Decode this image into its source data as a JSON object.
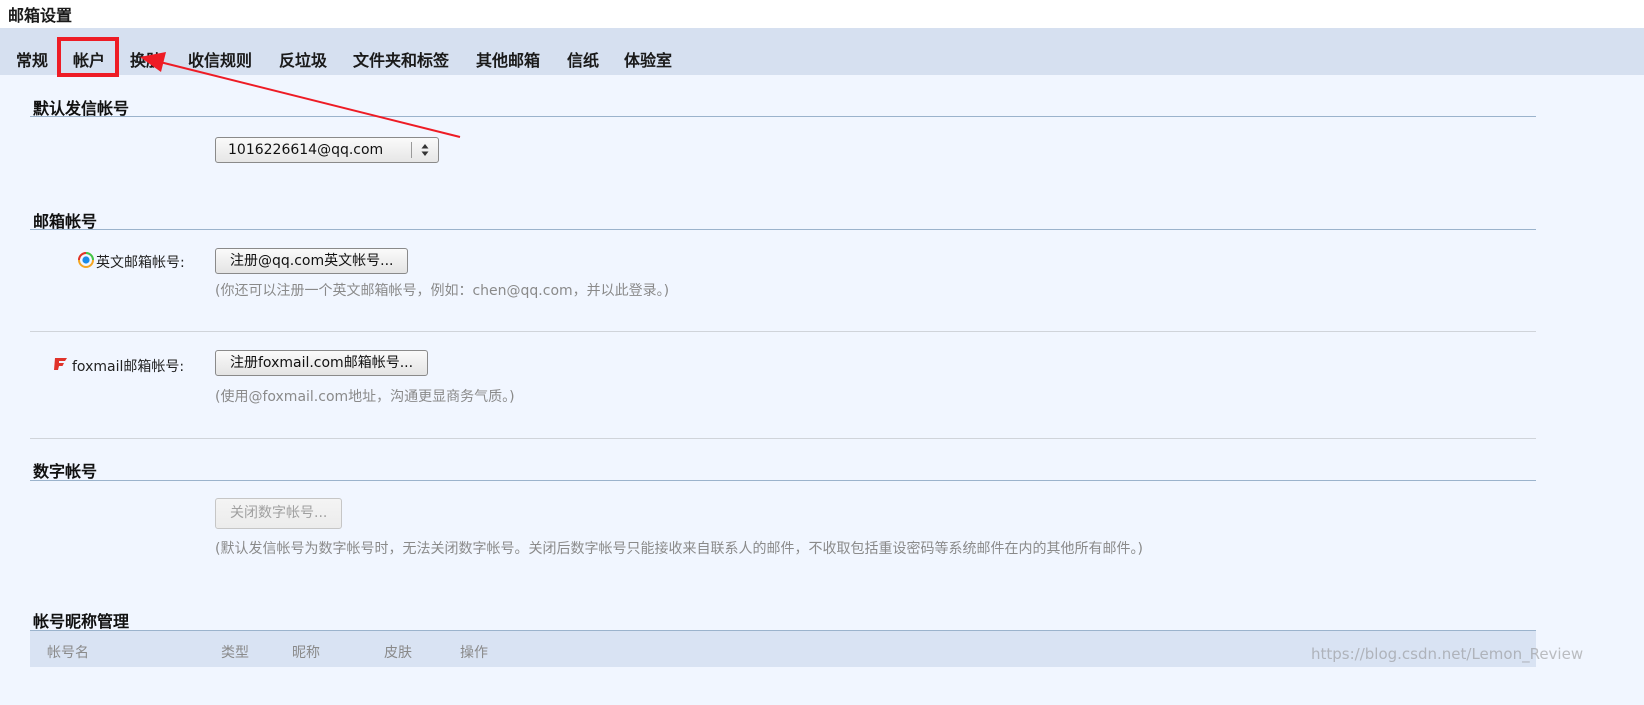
{
  "page": {
    "title": "邮箱设置"
  },
  "tabs": [
    {
      "label": "常规"
    },
    {
      "label": "帐户"
    },
    {
      "label": "换肤"
    },
    {
      "label": "收信规则"
    },
    {
      "label": "反垃圾"
    },
    {
      "label": "文件夹和标签"
    },
    {
      "label": "其他邮箱"
    },
    {
      "label": "信纸"
    },
    {
      "label": "体验室"
    }
  ],
  "active_tab": "帐户",
  "default_sender": {
    "title": "默认发信帐号",
    "selected": "1016226614@qq.com"
  },
  "mailbox_accounts": {
    "title": "邮箱帐号",
    "english": {
      "label": "英文邮箱帐号:",
      "button": "注册@qq.com英文帐号...",
      "hint": "(你还可以注册一个英文邮箱帐号，例如：chen@qq.com，并以此登录。)"
    },
    "foxmail": {
      "label": "foxmail邮箱帐号:",
      "button": "注册foxmail.com邮箱帐号...",
      "hint": "(使用@foxmail.com地址，沟通更显商务气质。)"
    }
  },
  "digit_account": {
    "title": "数字帐号",
    "button": "关闭数字帐号...",
    "hint": "(默认发信帐号为数字帐号时，无法关闭数字帐号。关闭后数字帐号只能接收来自联系人的邮件，不收取包括重设密码等系统邮件在内的其他所有邮件。)"
  },
  "nickname_mgmt": {
    "title": "帐号昵称管理",
    "columns": [
      "帐号名",
      "类型",
      "昵称",
      "皮肤",
      "操作"
    ]
  },
  "watermark": "https://blog.csdn.net/Lemon_Review",
  "colors": {
    "tab_bar": "#d6e0f0",
    "content_bg": "#f1f6ff",
    "annotation": "#ee1c25"
  }
}
